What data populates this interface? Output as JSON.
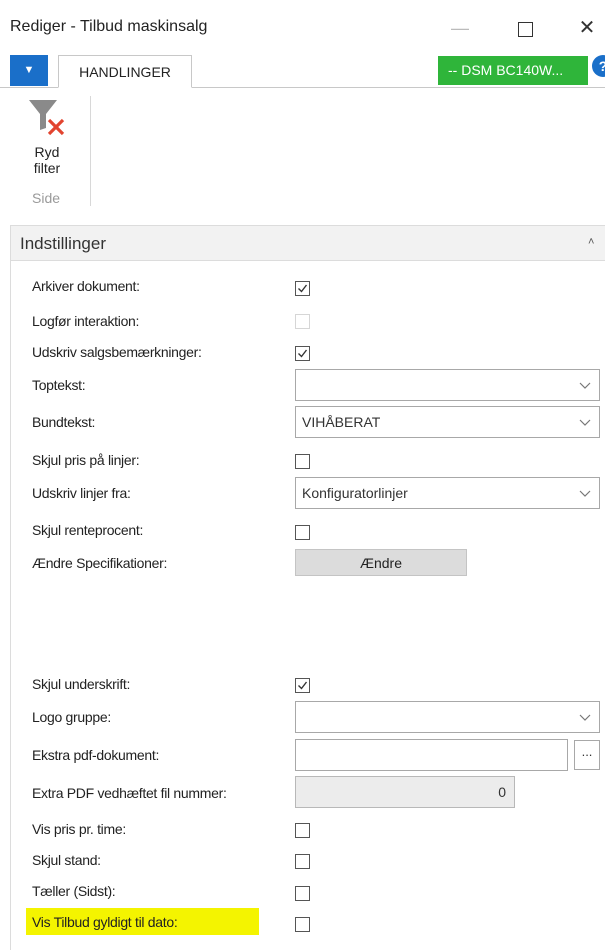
{
  "window": {
    "title": "Rediger - Tilbud maskinsalg",
    "minimize_glyph": "—",
    "close_glyph": "✕"
  },
  "ribbon": {
    "menu_glyph": "▼",
    "tab_label": "HANDLINGER",
    "record_badge": "-- DSM BC140W...",
    "help_glyph": "?",
    "clear_filter_label_line1": "Ryd",
    "clear_filter_label_line2": "filter",
    "group_label": "Side"
  },
  "fasttab": {
    "title": "Indstillinger",
    "chevron_glyph": "˄"
  },
  "fields": {
    "arkiver_dokument": {
      "label": "Arkiver dokument:",
      "checked": true
    },
    "logfor_interaktion": {
      "label": "Logfør interaktion:",
      "checked": false,
      "enabled": false
    },
    "udskriv_salgsbemaerkninger": {
      "label": "Udskriv salgsbemærkninger:",
      "checked": true
    },
    "toptekst": {
      "label": "Toptekst:",
      "value": ""
    },
    "bundtekst": {
      "label": "Bundtekst:",
      "value": "VIHÅBERAT"
    },
    "skjul_pris": {
      "label": "Skjul pris på linjer:",
      "checked": false
    },
    "udskriv_linjer_fra": {
      "label": "Udskriv linjer fra:",
      "value": "Konfiguratorlinjer"
    },
    "skjul_renteprocent": {
      "label": "Skjul renteprocent:",
      "checked": false
    },
    "aendre_specifikationer": {
      "label": "Ændre Specifikationer:",
      "button_label": "Ændre"
    },
    "skjul_underskrift": {
      "label": "Skjul underskrift:",
      "checked": true
    },
    "logo_gruppe": {
      "label": "Logo gruppe:",
      "value": ""
    },
    "ekstra_pdf": {
      "label": "Ekstra pdf-dokument:",
      "value": "",
      "assist_label": "..."
    },
    "extra_pdf_nummer": {
      "label": "Extra PDF vedhæftet fil nummer:",
      "value": "0"
    },
    "vis_pris_pr_time": {
      "label": "Vis pris pr. time:",
      "checked": false
    },
    "skjul_stand": {
      "label": "Skjul stand:",
      "checked": false
    },
    "taeller_sidst": {
      "label": "Tæller (Sidst):",
      "checked": false
    },
    "vis_tilbud_gyldigt": {
      "label": "Vis Tilbud gyldigt til dato:",
      "checked": false,
      "highlight_color": "#f4f400"
    }
  },
  "colors": {
    "accent_blue": "#1a6fc9",
    "badge_green": "#2fb53a",
    "highlight_yellow": "#f4f400"
  }
}
